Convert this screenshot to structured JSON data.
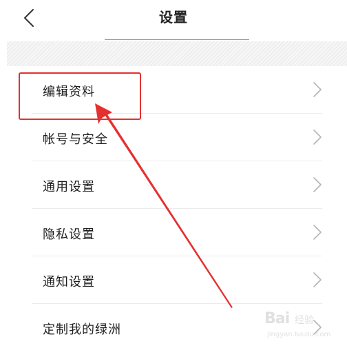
{
  "header": {
    "title": "设置"
  },
  "settings": {
    "items": [
      {
        "label": "编辑资料"
      },
      {
        "label": "帐号与安全"
      },
      {
        "label": "通用设置"
      },
      {
        "label": "隐私设置"
      },
      {
        "label": "通知设置"
      },
      {
        "label": "定制我的绿洲"
      }
    ]
  },
  "colors": {
    "annotation": "#e53030",
    "text": "#1f1f1f",
    "chevron": "#b5b5b5"
  },
  "watermark": {
    "brand": "Bai",
    "sub": "经验",
    "url": "jingyan.baidu.com"
  }
}
